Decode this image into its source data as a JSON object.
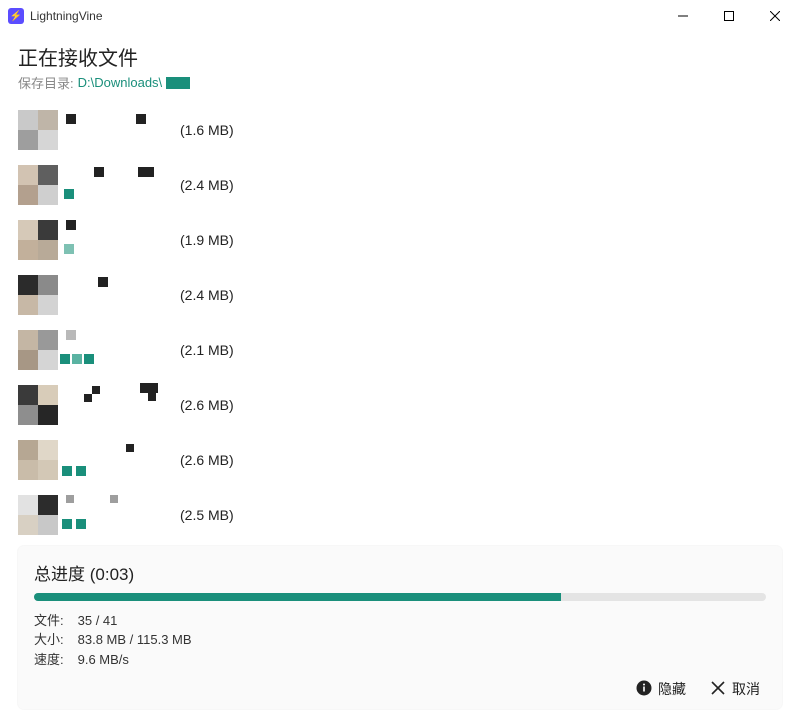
{
  "titlebar": {
    "title": "LightningVine"
  },
  "header": {
    "title": "正在接收文件",
    "save_label": "保存目录:",
    "save_path": "D:\\Downloads\\"
  },
  "files": [
    {
      "size": "(1.6 MB)"
    },
    {
      "size": "(2.4 MB)"
    },
    {
      "size": "(1.9 MB)"
    },
    {
      "size": "(2.4 MB)"
    },
    {
      "size": "(2.1 MB)"
    },
    {
      "size": "(2.6 MB)"
    },
    {
      "size": "(2.6 MB)"
    },
    {
      "size": "(2.5 MB)"
    }
  ],
  "progress": {
    "title_prefix": "总进度",
    "time": "(0:03)",
    "percent": 72,
    "file_label": "文件:",
    "file_value": "35 / 41",
    "size_label": "大小:",
    "size_value": "83.8 MB / 115.3 MB",
    "speed_label": "速度:",
    "speed_value": "9.6 MB/s"
  },
  "actions": {
    "hide": "隐藏",
    "cancel": "取消"
  }
}
